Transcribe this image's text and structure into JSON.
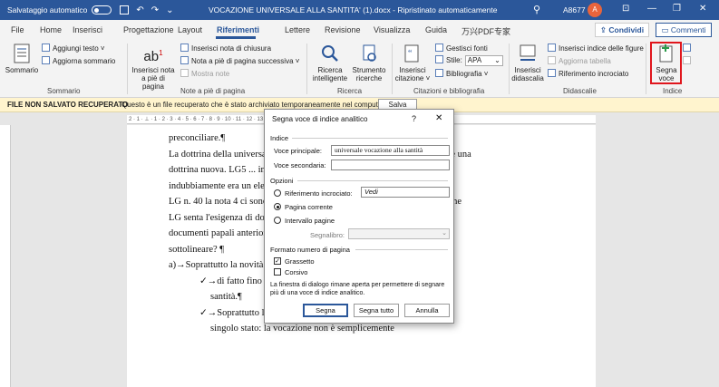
{
  "titlebar": {
    "autosave_label": "Salvataggio automatico",
    "doc_title": "VOCAZIONE UNIVERSALE ALLA SANTITA' (1).docx  -  Ripristinato automaticamente",
    "user": "A8677",
    "avatar_letter": "A",
    "search_glyph": "⚲",
    "minimize": "—",
    "restore": "❐",
    "close": "✕",
    "layout_glyph": "⊡"
  },
  "menu": {
    "tabs": [
      "File",
      "Home",
      "Inserisci",
      "Progettazione",
      "Layout",
      "Riferimenti",
      "Lettere",
      "Revisione",
      "Visualizza",
      "Guida",
      "万兴PDF专家"
    ],
    "share": "Condividi",
    "comments": "Commenti"
  },
  "ribbon": {
    "sommario": {
      "big": "Sommario",
      "add_text": "Aggiungi testo ˅",
      "update": "Aggiorna sommario",
      "group": "Sommario"
    },
    "note": {
      "big1": "Inserisci nota a piè di pagina",
      "big_glyph": "ab",
      "big_sup": "1",
      "endnote": "Inserisci nota di chiusura",
      "next": "Nota a piè di pagina successiva ˅",
      "show": "Mostra note",
      "group": "Note a piè di pagina"
    },
    "ricerca": {
      "smart": "Ricerca intelligente",
      "researcher": "Strumento ricerche",
      "group": "Ricerca"
    },
    "citazioni": {
      "insert": "Inserisci citazione ˅",
      "manage": "Gestisci fonti",
      "style_label": "Stile:",
      "style_value": "APA",
      "biblio": "Bibliografia ˅",
      "group": "Citazioni e bibliografia"
    },
    "didascalie": {
      "insert": "Inserisci didascalia",
      "figures": "Inserisci indice delle figure",
      "update": "Aggiorna tabella",
      "crossref": "Riferimento incrociato",
      "group": "Didascalie"
    },
    "indice": {
      "mark": "Segna voce",
      "group": "Indice"
    }
  },
  "messagebar": {
    "title": "FILE NON SALVATO RECUPERATO",
    "text": "Questo è un file recuperato che è stato archiviato temporaneamente nel computer.",
    "button": "Salva"
  },
  "ruler": {
    "marks": "2 · 1 · ⊥ · 1 · 2 · 3 · 4 · 5 · 6 · 7 · 8 · 9 · 10 · 11 · 12 · 13 · 14 · 15 · △ · 17 · 18"
  },
  "document": {
    "lines": [
      "preconciliare.¶",
      "La dottrina della universale vocazione alla santità non è definita LG5 non è una",
      "dottrina nuova. LG5 ... incolla e copia ... incolla, però",
      "indubbiamente era un elemento di novità nell'ambito preconciliare. ¶",
      "LG n. 40 la nota 4 ci sono documenti pontifici precedenti: è significativo che",
      "LG senta l'esigenza di dover citare il Popolo di Dio a questi 5",
      "documenti papali anteriori al Concilio, è cosa che ci interessa",
      "sottolineare? ¶",
      "a)→Soprattutto la novità: non è una dottrina nuova.¶",
      "✓→di fatto fino al Concilio: vocazione alla perfezione, e",
      "santità.¶",
      "✓→Soprattutto la vocazione alla perfezione ad un",
      "singolo stato: la vocazione non è semplicemente"
    ]
  },
  "dialog": {
    "title": "Segna voce di indice analitico",
    "help": "?",
    "close": "✕",
    "section_index": "Indice",
    "main_label": "Voce principale:",
    "main_value": "universale vocazione alla santità",
    "sub_label": "Voce secondaria:",
    "sub_value": "",
    "section_options": "Opzioni",
    "opt_crossref": "Riferimento incrociato:",
    "crossref_value": "Vedi",
    "opt_current": "Pagina corrente",
    "opt_range": "Intervallo pagine",
    "bookmark_label": "Segnalibro:",
    "section_format": "Formato numero di pagina",
    "bold": "Grassetto",
    "bold_checked": true,
    "italic": "Corsivo",
    "italic_checked": false,
    "note": "La finestra di dialogo rimane aperta per permettere di segnare più di una voce di indice analitico.",
    "btn_mark": "Segna",
    "btn_mark_all": "Segna tutto",
    "btn_cancel": "Annulla"
  },
  "colors": {
    "titlebar": "#2b579a",
    "highlight": "#e0161d",
    "avatar": "#e8643c",
    "msgbar": "#fff4ce"
  }
}
